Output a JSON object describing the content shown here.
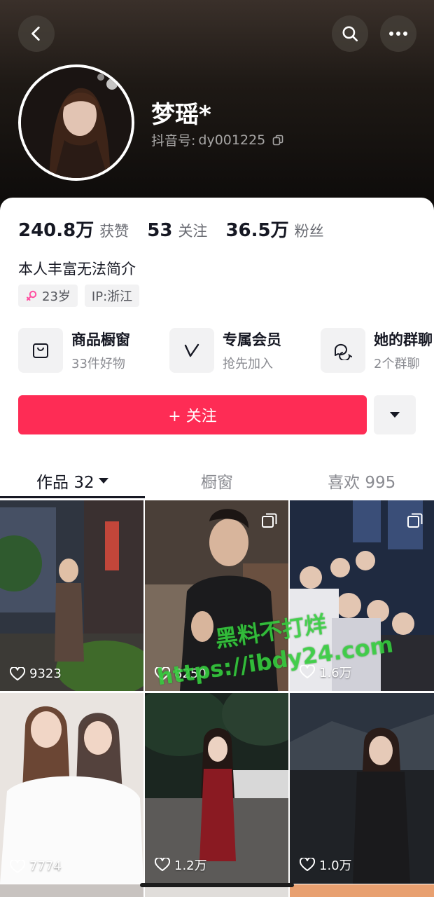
{
  "header": {
    "back_icon": "chevron-left-icon",
    "search_icon": "search-icon",
    "more_icon": "more-horizontal-icon"
  },
  "profile": {
    "name": "梦瑶*",
    "id_label": "抖音号:",
    "id_value": "dy001225",
    "copy_icon": "copy-icon"
  },
  "stats": [
    {
      "num": "240.8万",
      "label": "获赞"
    },
    {
      "num": "53",
      "label": "关注"
    },
    {
      "num": "36.5万",
      "label": "粉丝"
    }
  ],
  "bio": "本人丰富无法简介",
  "tags": {
    "age": "23岁",
    "ip": "IP:浙江"
  },
  "services": [
    {
      "title": "商品橱窗",
      "sub": "33件好物",
      "icon": "shopping-bag-icon"
    },
    {
      "title": "专属会员",
      "sub": "抢先加入",
      "icon": "v-badge-icon"
    },
    {
      "title": "她的群聊",
      "sub": "2个群聊",
      "icon": "chat-bubbles-icon"
    }
  ],
  "follow_button": "+ 关注",
  "tabs": [
    {
      "label": "作品 32"
    },
    {
      "label": "橱窗"
    },
    {
      "label": "喜欢 995"
    }
  ],
  "videos": [
    {
      "likes": "9323"
    },
    {
      "likes": "8250"
    },
    {
      "likes": "1.6万"
    },
    {
      "likes": "7774"
    },
    {
      "likes": "1.2万"
    },
    {
      "likes": "1.0万"
    }
  ],
  "watermark": {
    "line1": "黑料不打烊",
    "line2": "https://ibdy24.com"
  },
  "colors": {
    "accent": "#fe2c55",
    "tag_female": "#ff4fa0"
  }
}
